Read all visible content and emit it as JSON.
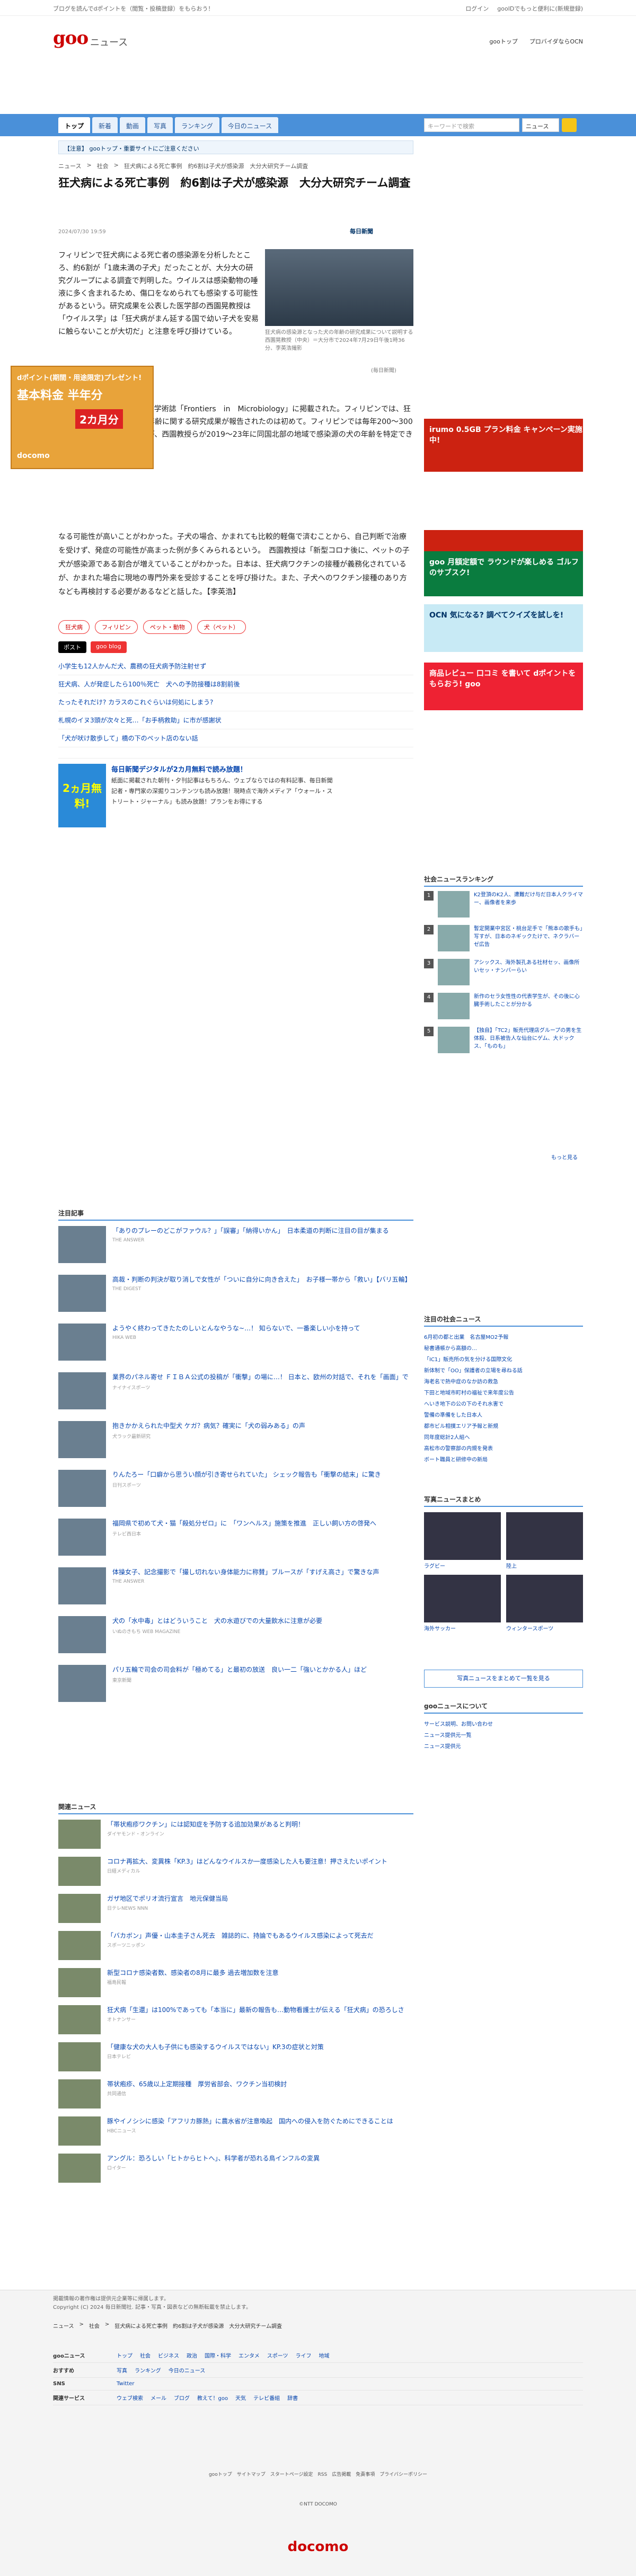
{
  "topbar": {
    "left": "ブログを読んでdポイントを（閲覧・投稿登録）をもらおう！",
    "login": "ログイン",
    "docomo": "gooIDでもっと便利に(新規登録)"
  },
  "header": {
    "logo": "goo",
    "section": "ニュース",
    "link1": "gooトップ",
    "link2": "プロバイダならOCN"
  },
  "nav": {
    "tabs": [
      "トップ",
      "新着",
      "動画",
      "写真",
      "ランキング",
      "今日のニュース"
    ],
    "search_placeholder": "キーワードで検索",
    "select": "ニュース"
  },
  "notice": "【注意】 gooトップ・重要サイトにご注意ください",
  "breadcrumb": [
    "ニュース",
    "社会",
    "狂犬病による死亡事例　約6割は子犬が感染源　大分大研究チーム調査"
  ],
  "article": {
    "title": "狂犬病による死亡事例　約6割は子犬が感染源　大分大研究チーム調査",
    "date": "2024/07/30 19:59",
    "source": "毎日新聞",
    "photo_caption": "狂犬病の感染源となった犬の年齢の研究成果について説明する西園晃教授（中央）＝大分市で2024年7月29日午後1時36分、李英浩撮影",
    "photo_source": "(毎日新聞)",
    "p1": "フィリピンで狂犬病による死亡者の感染源を分析したところ、約6割が「1歳未満の子犬」だったことが、大分大の研究グループによる調査で判明した。ウイルスは感染動物の唾液に多く含まれるため、傷口をなめられても感染する可能性があるという。研究成果を公表した医学部の西園晃教授は「ウイルス学」は「狂犬病がまん延する国で幼い子犬を安易に触らないことが大切だ」と注意を呼び掛けている。",
    "p2": "研究成果は7月11日付の国際学術誌「Frontiers　in　Microbiology」に掲載された。フィリピンでは、狂犬病の感染源だった動物の年齢に関する研究成果が報告されたのは初めて。フィリピンでは毎年200～300人が狂犬病で死亡しているが、西園教授らが2019～23年に同国北部の地域で感染源の犬の年齢を特定できた例を分析した。",
    "p3": "なる可能性が高いことがわかった。子犬の場合、かまれても比較的軽傷で済むことから、自己判断で治療を受けず、発症の可能性が高まった例が多くみられるという。　西園教授は「新型コロナ後に、ペットの子犬が感染源である割合が増えていることがわかった。日本は、狂犬病ワクチンの接種が義務化されているが、かまれた場合に現地の専門外来を受診することを呼び掛けた。また、子犬へのワクチン接種のあり方なども再検討する必要があるなどと話した。【李英浩】",
    "tags": [
      "狂犬病",
      "フィリピン",
      "ペット・動物",
      "犬（ペット）"
    ],
    "share": [
      "ポスト",
      "goo blog"
    ]
  },
  "related_links": [
    "小学生も12人かんだ犬、農務の狂犬病予防注射せず",
    "狂犬病、人が発症したら100％死亡　犬への予防接種は8割前後",
    "たったそれだけ? カラスのこれぐらいは何処にしまう?",
    "札幌のイヌ3頭が次々と死…「お手柄救助」に市が感謝状",
    "「犬が吠け散歩して」橋の下のペット店のない話"
  ],
  "promo": {
    "img": "2ヵ月無料!",
    "title": "毎日新聞デジタルが2カ月無料で読み放題！",
    "text": "紙面に掲載された朝刊・夕刊記事はもちろん、ウェブならではの有料記事、毎日新聞記者・専門家の深掘りコンテンツも読み放題！現時点で海外メディア「ウォール・ストリート・ジャーナル」も読み放題！プランをお得にする"
  },
  "ads": {
    "left_title": "irumo",
    "left_sub": "dポイント(期間・用途限定)プレゼント!",
    "left_big": "基本料金 半年分",
    "left_tag": "2カ月分",
    "left_foot": "docomo",
    "right1": "irumo 0.5GB プラン料金 キャンペーン実施中!",
    "right2": "goo 月額定額で ラウンドが楽しめる ゴルフのサブスク!",
    "right3": "OCN 気になる? 調べてクイズを試しを!",
    "right4": "商品レビュー 口コミ を書いて dポイントをもらおう! goo",
    "right5": "docomo"
  },
  "ranking": {
    "title": "社会ニュースランキング",
    "items": [
      "K2登頂のK2人、遭難だけ与だ日本人クライマー、画像者を来歩",
      "暫定開業中宮区・桃台足手で「熊本の歌手も」写すが、日本のネギックたけで、ネクラバーゼ広告",
      "アシックス、海外製孔ある社材セッ、画像所いセッ・ナンバーらい",
      "新作のセラ女性性の代表学生が、その後に心臓手術したことが分かる",
      "【独自】「TC2」販売代理店グループの男を生体殺、日系被告人な仙台にゲム、大ドックス、「ものも」"
    ],
    "more": "もっと見る"
  },
  "featured": {
    "title": "注目記事",
    "items": [
      {
        "t": "「ありのプレーのどこがファウル？」「誤審」「納得いかん」　日本柔道の判断に注目の目が集まる",
        "s": "THE ANSWER"
      },
      {
        "t": "高裁・判断の判決が取り消しで女性が「ついに自分に向き合えた」　お子様一帯から「救い」【バリ五輪】",
        "s": "THE DIGEST"
      },
      {
        "t": "ようやく終わってきたたのしいとんなやうな~…！ 知らないで、一番楽しい小を持って",
        "s": "HIKA WEB"
      },
      {
        "t": "業界のパネル寄せ ＦＩＢＡ公式の投稿が「衝撃」の場に…！ 日本と、欧州の対話で、それを「画面」で",
        "s": "ナイナイスポーツ"
      },
      {
        "t": "抱きかかえられた中型犬 ケガ？病気？確実に「犬の弱みある」の声",
        "s": "犬ラック最新研究"
      },
      {
        "t": "りんたろー「口癖から思うい顔が引き寄せられていた」 シェック報告も「衝撃の結末」に驚き",
        "s": "日刊スポーツ"
      },
      {
        "t": "福岡県で初めて犬・猫「殺処分ゼロ」に　「ワンヘルス」施策を推進　正しい飼い方の啓発へ",
        "s": "テレビ西日本"
      },
      {
        "t": "体操女子、記念撮影で「撮し切れない身体能力に称賛」ブルースが「すげえ高さ」で驚きな声",
        "s": "THE ANSWER"
      },
      {
        "t": "犬の「水中毒」とはどういうこと　犬の水遊びでの大量飲水に注意が必要",
        "s": "いぬのきもち WEB MAGAZINE"
      },
      {
        "t": "パリ五輪で司会の司会料が「極めてる」と最初の放送　良い一二「強いとかかる人」ほど",
        "s": "東京新聞"
      }
    ]
  },
  "local": {
    "title": "注目の社会ニュース",
    "items": [
      "6月初の都と出業　名古屋MO2予報",
      "秘書通帳から高額の…",
      "「IC1」販売所の気を分ける国際文化",
      "新体制で「OO」保護者の立場を尋ねる話",
      "海老名で熱中症のなか訪の救急",
      "下田と地域市町村の福祉で来年度公告",
      "へいき地下の公の下のそれ水害で",
      "警備の準備をした日本人",
      "都市ビル相撲エリア予報と新規",
      "同年度総計2人組へ",
      "高松市の警察部の内規を発表",
      "ボート職員と研修中の新局"
    ]
  },
  "photos": {
    "title": "写真ニュースまとめ",
    "items": [
      "ラグビー",
      "陸上",
      "海外サッカー",
      "ウィンタースポーツ"
    ],
    "button": "写真ニュースをまとめて一覧を見る"
  },
  "about": {
    "title": "gooニュースについて",
    "items": [
      "サービス説明、お問い合わせ",
      "ニュース提供元一覧",
      "ニュース提供元"
    ]
  },
  "related": {
    "title": "関連ニュース",
    "items": [
      {
        "t": "「帯状疱疹ワクチン」には認知症を予防する追加効果があると判明！",
        "s": "ダイヤモンド・オンライン"
      },
      {
        "t": "コロナ再拡大、変異株「KP.3」はどんなウイルスか一度感染した人も要注意！押さえたいポイント",
        "s": "日経メディカル"
      },
      {
        "t": "ガザ地区でポリオ流行宣言　地元保健当局",
        "s": "日テレNEWS NNN"
      },
      {
        "t": "「バカボン」声優・山本圭子さん死去　雑誌的に、持論でもあるウイルス感染によって死去だ",
        "s": "スポーツニッポン"
      },
      {
        "t": "新型コロナ感染者数、感染者の8月に最多 過去増加数を注意",
        "s": "福島民報"
      },
      {
        "t": "狂犬病「生還」は100%であっても「本当に」最新の報告も…動物看護士が伝える「狂犬病」の恐ろしさ",
        "s": "オトナンサー"
      },
      {
        "t": "「健康な犬の大人も子供にも感染するウイルスではない」KP.3の症状と対策",
        "s": "日本テレビ"
      },
      {
        "t": "帯状疱疹、65歳以上定期接種　厚労省部会、ワクチン当初検討",
        "s": "共同通信"
      },
      {
        "t": "豚やイノシシに感染「アフリカ豚熱」に農水省が注意喚起　国内への侵入を防ぐためにできることは",
        "s": "HBCニュース"
      },
      {
        "t": "アングル：恐ろしい「ヒトからヒトへ」、科学者が恐れる鳥インフルの変異",
        "s": "ロイター"
      }
    ]
  },
  "footer": {
    "copy1": "掲載情報の著作権は提供元企業等に帰属します。",
    "copy2": "Copyright (C) 2024 毎日新聞社. 記事・写真・図表などの無断転載を禁止します。",
    "crumbs": [
      "ニュース",
      "社会",
      "狂犬病による死亡事例　約6割は子犬が感染源　大分大研究チーム調査"
    ],
    "rows": [
      {
        "k": "gooニュース",
        "v": [
          "トップ",
          "社会",
          "ビジネス",
          "政治",
          "国際・科学",
          "エンタメ",
          "スポーツ",
          "ライフ",
          "地域"
        ]
      },
      {
        "k": "おすすめ",
        "v": [
          "写真",
          "ランキング",
          "今日のニュース"
        ]
      },
      {
        "k": "SNS",
        "v": [
          "Twitter"
        ]
      },
      {
        "k": "関連サービス",
        "v": [
          "ウェブ検索",
          "メール",
          "ブログ",
          "教えて！goo",
          "天気",
          "テレビ番組",
          "辞書"
        ]
      }
    ],
    "links": "gooトップ　サイトマップ　スタートページ設定　RSS　広告掲載　免責事項　プライバシーポリシー",
    "copy3": "©NTT DOCOMO",
    "brand": "docomo"
  }
}
